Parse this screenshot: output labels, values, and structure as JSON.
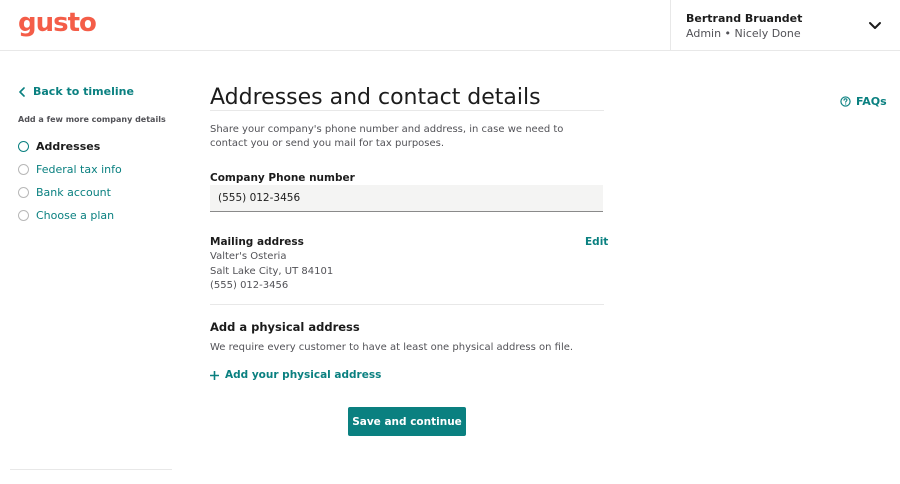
{
  "brand": {
    "logo": "gusto",
    "accent": "#0a8080",
    "logo_color": "#f45d48"
  },
  "user": {
    "name": "Bertrand Bruandet",
    "role": "Admin • Nicely Done",
    "chevron_icon": "chevron-down-icon"
  },
  "sidebar": {
    "back_label": "Back to timeline",
    "steps_title": "Add a few more company details",
    "steps": [
      {
        "label": "Addresses",
        "active": true
      },
      {
        "label": "Federal tax info",
        "active": false
      },
      {
        "label": "Bank account",
        "active": false
      },
      {
        "label": "Choose a plan",
        "active": false
      }
    ]
  },
  "main": {
    "title": "Addresses and contact details",
    "intro": "Share your company's phone number and address, in case we need to contact you or send you mail for tax purposes.",
    "phone_label": "Company Phone number",
    "phone_value": "(555) 012-3456",
    "mailing": {
      "label": "Mailing address",
      "lines": [
        "Valter's Osteria",
        "Salt Lake City, UT 84101",
        "(555) 012-3456"
      ],
      "edit_label": "Edit"
    },
    "physical": {
      "title": "Add a physical address",
      "description": "We require every customer to have at least one physical address on file.",
      "add_label": "Add your physical address"
    },
    "save_label": "Save and continue"
  },
  "help": {
    "faqs_label": "FAQs",
    "icon": "help-circle-icon"
  }
}
